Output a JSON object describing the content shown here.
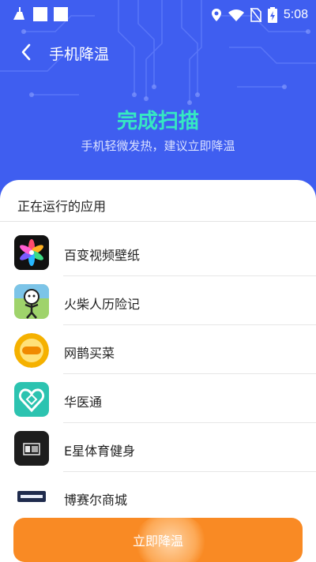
{
  "status_bar": {
    "time": "5:08"
  },
  "header": {
    "title": "手机降温"
  },
  "scan": {
    "title": "完成扫描",
    "subtitle": "手机轻微发热，建议立即降温"
  },
  "section": {
    "title": "正在运行的应用"
  },
  "apps": [
    {
      "label": "百变视频壁纸"
    },
    {
      "label": "火柴人历险记"
    },
    {
      "label": "网鹊买菜"
    },
    {
      "label": "华医通"
    },
    {
      "label": "E星体育健身"
    },
    {
      "label": "博赛尔商城"
    }
  ],
  "button": {
    "label": "立即降温"
  },
  "colors": {
    "header_bg": "#3f5ef0",
    "accent": "#36e8c2",
    "cta": "#f98a24"
  }
}
